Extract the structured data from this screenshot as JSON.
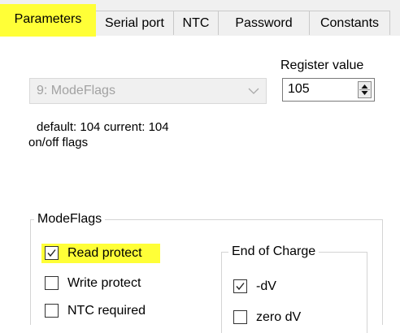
{
  "tabs": [
    {
      "label": "Parameters",
      "active": true
    },
    {
      "label": "Serial port",
      "active": false
    },
    {
      "label": "NTC",
      "active": false
    },
    {
      "label": "Password",
      "active": false
    },
    {
      "label": "Constants",
      "active": false
    }
  ],
  "parameter_select": {
    "value": "9: ModeFlags",
    "icon": "chevron-down-icon"
  },
  "register": {
    "label": "Register value",
    "value": "105"
  },
  "info": {
    "defaults": "default: 104 current: 104",
    "description": "on/off flags"
  },
  "modeflags": {
    "title": "ModeFlags",
    "checkboxes": [
      {
        "label": "Read protect",
        "checked": true
      },
      {
        "label": "Write protect",
        "checked": false
      },
      {
        "label": "NTC required",
        "checked": false
      }
    ]
  },
  "end_of_charge": {
    "title": "End of Charge",
    "checkboxes": [
      {
        "label": "-dV",
        "checked": true
      },
      {
        "label": "zero dV",
        "checked": false
      }
    ]
  },
  "colors": {
    "highlight": "#ffff37",
    "disabled_text": "#a2a2a2",
    "tab_background": "#f0f0f0"
  }
}
